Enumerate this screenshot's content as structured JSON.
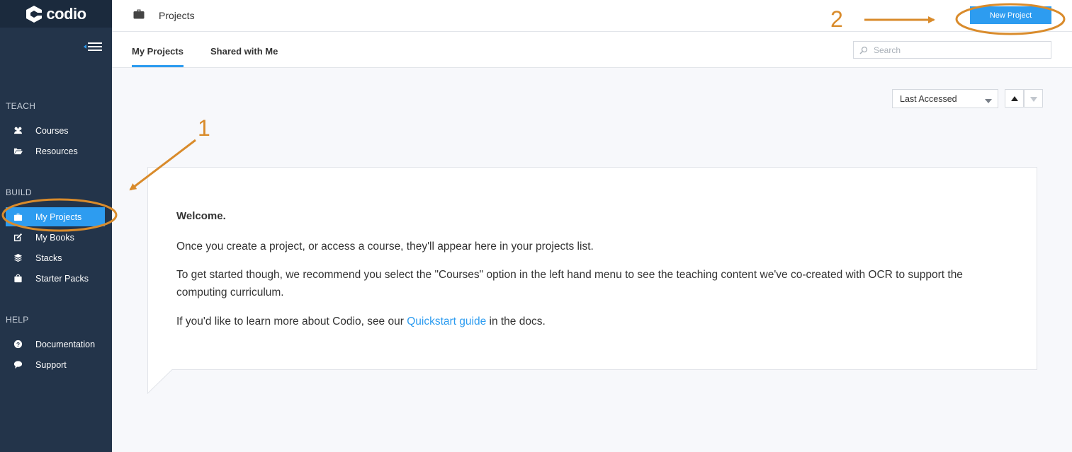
{
  "brand": {
    "name": "codio"
  },
  "sidebar": {
    "sections": [
      {
        "label": "TEACH"
      },
      {
        "label": "BUILD"
      },
      {
        "label": "HELP"
      }
    ],
    "items": [
      {
        "label": "Courses",
        "icon": "users-icon"
      },
      {
        "label": "Resources",
        "icon": "folder-open-icon"
      },
      {
        "label": "My Projects",
        "icon": "briefcase-icon",
        "active": true
      },
      {
        "label": "My Books",
        "icon": "edit-icon"
      },
      {
        "label": "Stacks",
        "icon": "stack-icon"
      },
      {
        "label": "Starter Packs",
        "icon": "bag-icon"
      },
      {
        "label": "Documentation",
        "icon": "question-icon"
      },
      {
        "label": "Support",
        "icon": "chat-icon"
      }
    ]
  },
  "header": {
    "title": "Projects",
    "new_project_label": "New Project"
  },
  "tabs": [
    {
      "label": "My Projects",
      "active": true
    },
    {
      "label": "Shared with Me",
      "active": false
    }
  ],
  "search": {
    "placeholder": "Search",
    "value": ""
  },
  "sort": {
    "selected": "Last Accessed"
  },
  "welcome": {
    "heading": "Welcome.",
    "line1": "Once you create a project, or access a course, they'll appear here in your projects list.",
    "line2": "To get started though, we recommend you select the \"Courses\" option in the left hand menu to see the teaching content we've co-created with OCR to support the computing curriculum.",
    "line3_before": "If you'd like to learn more about Codio, see our ",
    "line3_link": "Quickstart guide",
    "line3_after": " in the docs."
  },
  "annotations": [
    {
      "label": "1"
    },
    {
      "label": "2"
    }
  ],
  "colors": {
    "sidebar_bg": "#23344a",
    "accent": "#2d9cf0",
    "annotation": "#d98b2b"
  }
}
